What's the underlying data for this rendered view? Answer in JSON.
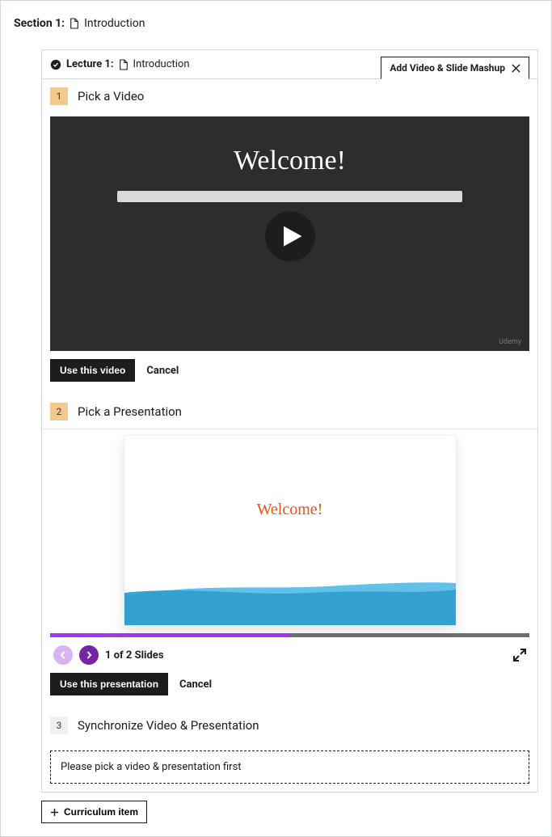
{
  "section": {
    "label": "Section 1:",
    "name": "Introduction"
  },
  "lecture": {
    "label": "Lecture 1:",
    "name": "Introduction",
    "mashup_label": "Add Video & Slide Mashup"
  },
  "step1": {
    "number": "1",
    "title": "Pick a Video",
    "video_title": "Welcome!",
    "use_btn": "Use this video",
    "cancel": "Cancel",
    "watermark": "Udemy"
  },
  "step2": {
    "number": "2",
    "title": "Pick a Presentation",
    "slide_title": "Welcome!",
    "progress_percent": "50%",
    "slide_counter": "1 of 2 Slides",
    "use_btn": "Use this presentation",
    "cancel": "Cancel"
  },
  "step3": {
    "number": "3",
    "title": "Synchronize Video & Presentation",
    "message": "Please pick a video & presentation first"
  },
  "curriculum_btn": "Curriculum item"
}
